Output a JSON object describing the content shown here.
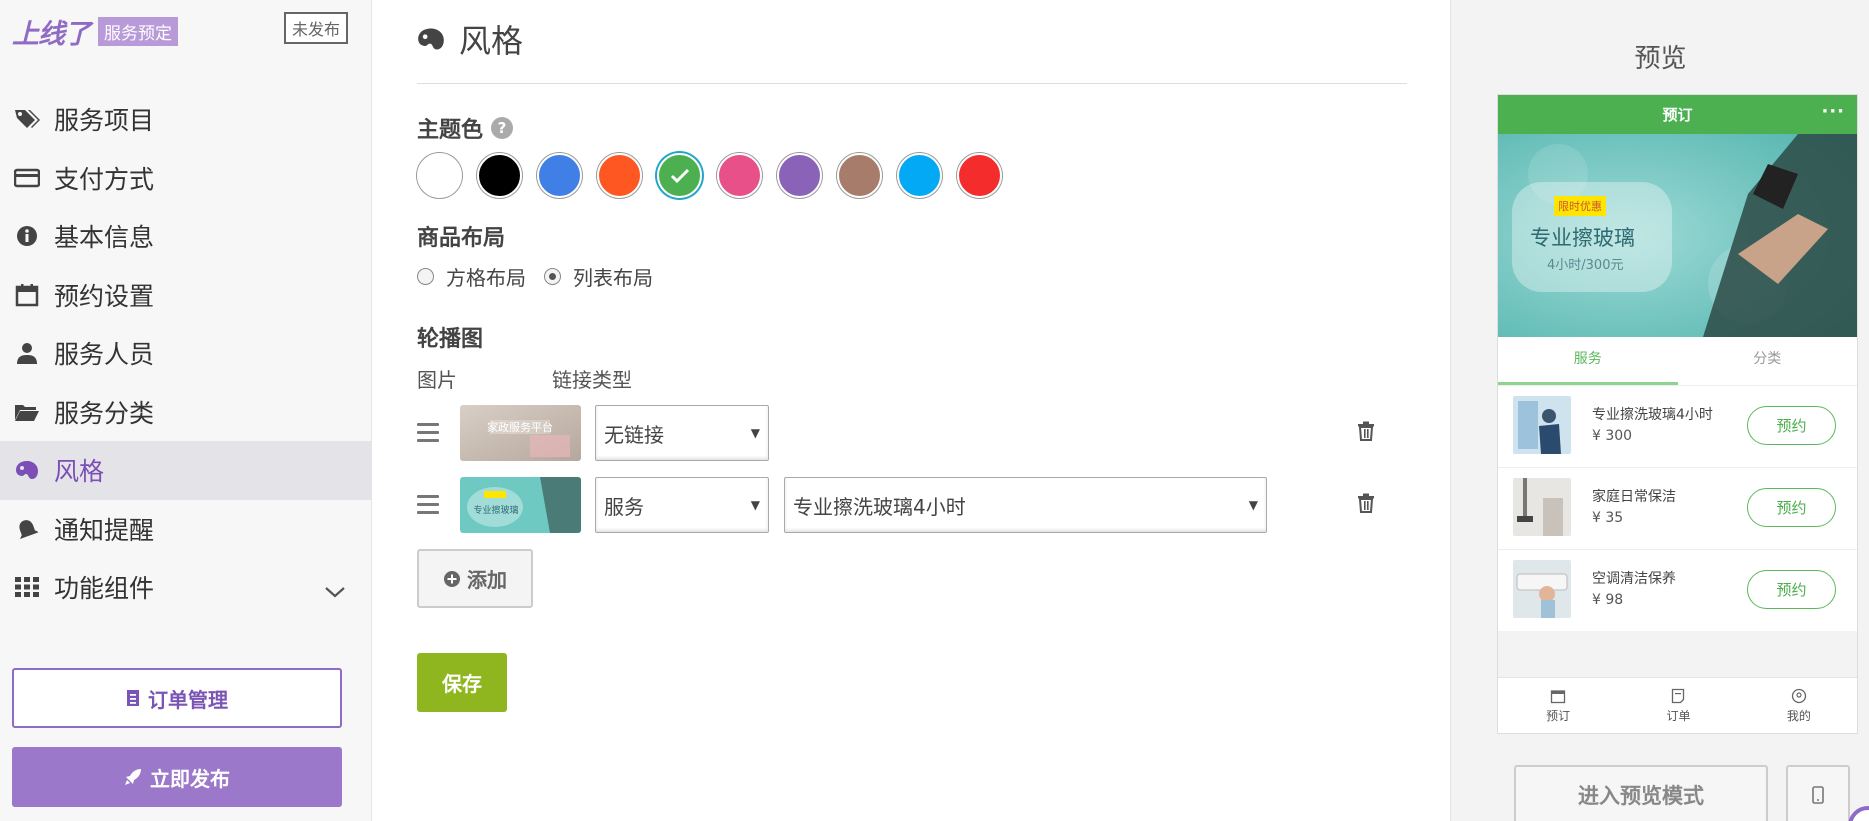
{
  "sidebar": {
    "brand": "上线了",
    "brand_tag": "服务预定",
    "status": "未发布",
    "items": [
      {
        "label": "服务项目",
        "icon": "tag-icon"
      },
      {
        "label": "支付方式",
        "icon": "credit-card-icon"
      },
      {
        "label": "基本信息",
        "icon": "info-icon"
      },
      {
        "label": "预约设置",
        "icon": "calendar-icon"
      },
      {
        "label": "服务人员",
        "icon": "user-icon"
      },
      {
        "label": "服务分类",
        "icon": "folder-icon"
      },
      {
        "label": "风格",
        "icon": "palette-icon",
        "active": true
      },
      {
        "label": "通知提醒",
        "icon": "bell-icon"
      },
      {
        "label": "功能组件",
        "icon": "grid-icon"
      }
    ],
    "orders_button": "订单管理",
    "publish_button": "立即发布"
  },
  "main": {
    "title": "风格",
    "theme_label": "主题色",
    "theme_help": "?",
    "colors": [
      "#ffffff",
      "#000000",
      "#3f7fe6",
      "#ff5722",
      "#4caf50",
      "#e8508a",
      "#8a63b8",
      "#a77c6a",
      "#03a9f4",
      "#f52c2c"
    ],
    "selected_color": "#4caf50",
    "layout_label": "商品布局",
    "layout_options": [
      "方格布局",
      "列表布局"
    ],
    "layout_selected": "列表布局",
    "carousel_label": "轮播图",
    "col_image": "图片",
    "col_link_type": "链接类型",
    "rows": [
      {
        "thumb_text": "家政服务平台",
        "link_type": "无链接",
        "target": ""
      },
      {
        "thumb_text": "专业擦玻璃",
        "link_type": "服务",
        "target": "专业擦洗玻璃4小时"
      }
    ],
    "add_button": "添加",
    "save_button": "保存"
  },
  "preview": {
    "title": "预览",
    "app_bar_title": "预订",
    "app_bar_more": "···",
    "banner": {
      "tag": "限时优惠",
      "title": "专业擦玻璃",
      "subtitle": "4小时/300元"
    },
    "tabs": [
      "服务",
      "分类"
    ],
    "active_tab": "服务",
    "services": [
      {
        "name": "专业擦洗玻璃4小时",
        "price": "¥ 300",
        "button": "预约"
      },
      {
        "name": "家庭日常保洁",
        "price": "¥ 35",
        "button": "预约"
      },
      {
        "name": "空调清洁保养",
        "price": "¥ 98",
        "button": "预约"
      }
    ],
    "bottom_nav": [
      "预订",
      "订单",
      "我的"
    ],
    "preview_mode_button": "进入预览模式"
  }
}
